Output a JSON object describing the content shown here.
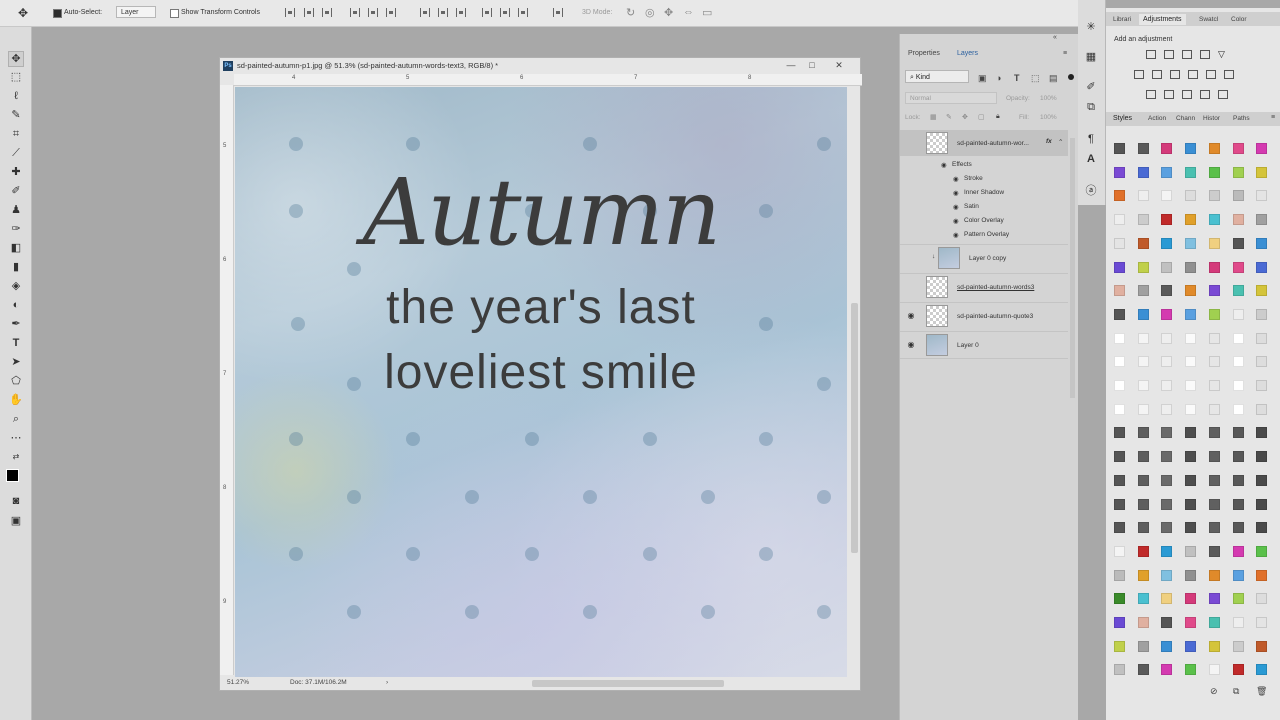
{
  "optionsbar": {
    "autoselect_label": "Auto-Select:",
    "autoselect_value": "Layer",
    "transform_label": "Show Transform Controls",
    "mode_3d": "3D Mode:"
  },
  "document": {
    "title": "sd-painted-autumn-p1.jpg @ 51.3% (sd-painted-autumn-words-text3, RGB/8) *",
    "ruler_top": [
      "4",
      "5",
      "6",
      "7",
      "8"
    ],
    "ruler_left": [
      "5",
      "6",
      "7",
      "8",
      "9"
    ],
    "text_autumn": "Autumn",
    "text_line1": "the year's last",
    "text_line2": "loveliest smile",
    "zoom": "51.27%",
    "doc_info": "Doc: 37.1M/106.2M"
  },
  "layers_panel": {
    "tabs": [
      "Properties",
      "Layers"
    ],
    "kind": "Kind",
    "blend": "Normal",
    "opacity_label": "Opacity:",
    "opacity_value": "100%",
    "lock_label": "Lock:",
    "fill_label": "Fill:",
    "fill_value": "100%",
    "layers": [
      {
        "name": "sd-painted-autumn-wor...",
        "fx": "fx"
      },
      {
        "name": "Effects"
      },
      {
        "name": "Stroke"
      },
      {
        "name": "Inner Shadow"
      },
      {
        "name": "Satin"
      },
      {
        "name": "Color Overlay"
      },
      {
        "name": "Pattern Overlay"
      },
      {
        "name": "Layer 0 copy"
      },
      {
        "name": "sd-painted-autumn-words3"
      },
      {
        "name": "sd-painted-autumn-quote3"
      },
      {
        "name": "Layer 0"
      }
    ]
  },
  "right_panel": {
    "tabs_top": [
      "Librari",
      "Adjustments",
      "Swatcl",
      "Color"
    ],
    "add_adjustment": "Add an adjustment",
    "tabs_styles": [
      "Styles",
      "Action",
      "Chann",
      "Histor",
      "Paths"
    ]
  },
  "colors": {
    "accent": "#2a5f9e",
    "text_on_canvas": "#3c3c3c"
  }
}
